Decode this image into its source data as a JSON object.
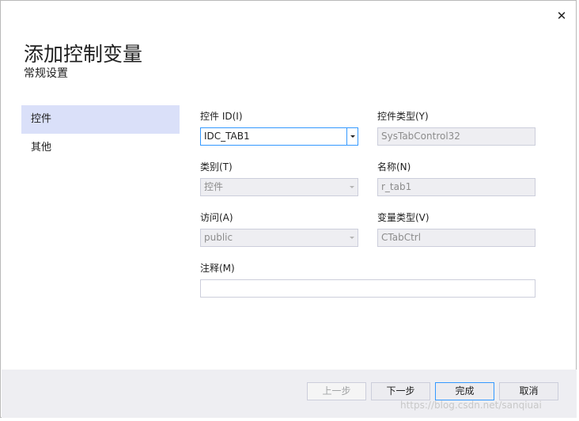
{
  "dialog": {
    "close_glyph": "✕",
    "title": "添加控制变量",
    "subtitle": "常规设置"
  },
  "nav": {
    "items": [
      {
        "label": "控件",
        "selected": true
      },
      {
        "label": "其他",
        "selected": false
      }
    ]
  },
  "form": {
    "control_id": {
      "label": "控件 ID(I)",
      "value": "IDC_TAB1"
    },
    "control_type": {
      "label": "控件类型(Y)",
      "value": "SysTabControl32"
    },
    "category": {
      "label": "类别(T)",
      "value": "控件"
    },
    "name": {
      "label": "名称(N)",
      "value": "r_tab1"
    },
    "access": {
      "label": "访问(A)",
      "value": "public"
    },
    "var_type": {
      "label": "变量类型(V)",
      "value": "CTabCtrl"
    },
    "comment": {
      "label": "注释(M)",
      "value": ""
    }
  },
  "buttons": {
    "prev": "上一步",
    "next": "下一步",
    "finish": "完成",
    "cancel": "取消"
  },
  "watermark": "https://blog.csdn.net/sanqiuai",
  "colors": {
    "accent": "#3399ff",
    "nav_selected": "#dae0f9",
    "footer": "#eeeef2"
  }
}
